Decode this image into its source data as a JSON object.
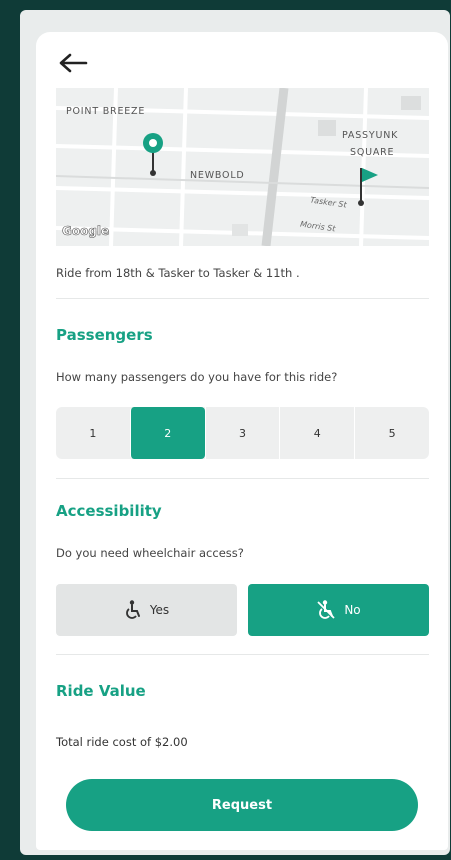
{
  "header": {
    "back_icon": "arrow-left-icon"
  },
  "map": {
    "labels": {
      "point_breeze": "POINT BREEZE",
      "newbold": "NEWBOLD",
      "passyunk_line1": "PASSYUNK",
      "passyunk_line2": "SQUARE",
      "tasker_st": "Tasker St",
      "morris_st": "Morris St"
    },
    "provider": "Google",
    "pickup_icon": "map-pin-icon",
    "dropoff_icon": "flag-icon"
  },
  "ride": {
    "description": "Ride from 18th & Tasker to Tasker & 11th ."
  },
  "passengers": {
    "title": "Passengers",
    "question": "How many passengers do you have for this ride?",
    "options": [
      "1",
      "2",
      "3",
      "4",
      "5"
    ],
    "selected": "2"
  },
  "accessibility": {
    "title": "Accessibility",
    "question": "Do you need wheelchair access?",
    "yes_label": "Yes",
    "no_label": "No",
    "yes_icon": "wheelchair-icon",
    "no_icon": "no-wheelchair-icon",
    "selected": "No"
  },
  "ride_value": {
    "title": "Ride Value",
    "total_text": "Total ride cost of $2.00"
  },
  "actions": {
    "request_label": "Request"
  },
  "colors": {
    "accent": "#17a184",
    "background": "#0f3b37"
  }
}
